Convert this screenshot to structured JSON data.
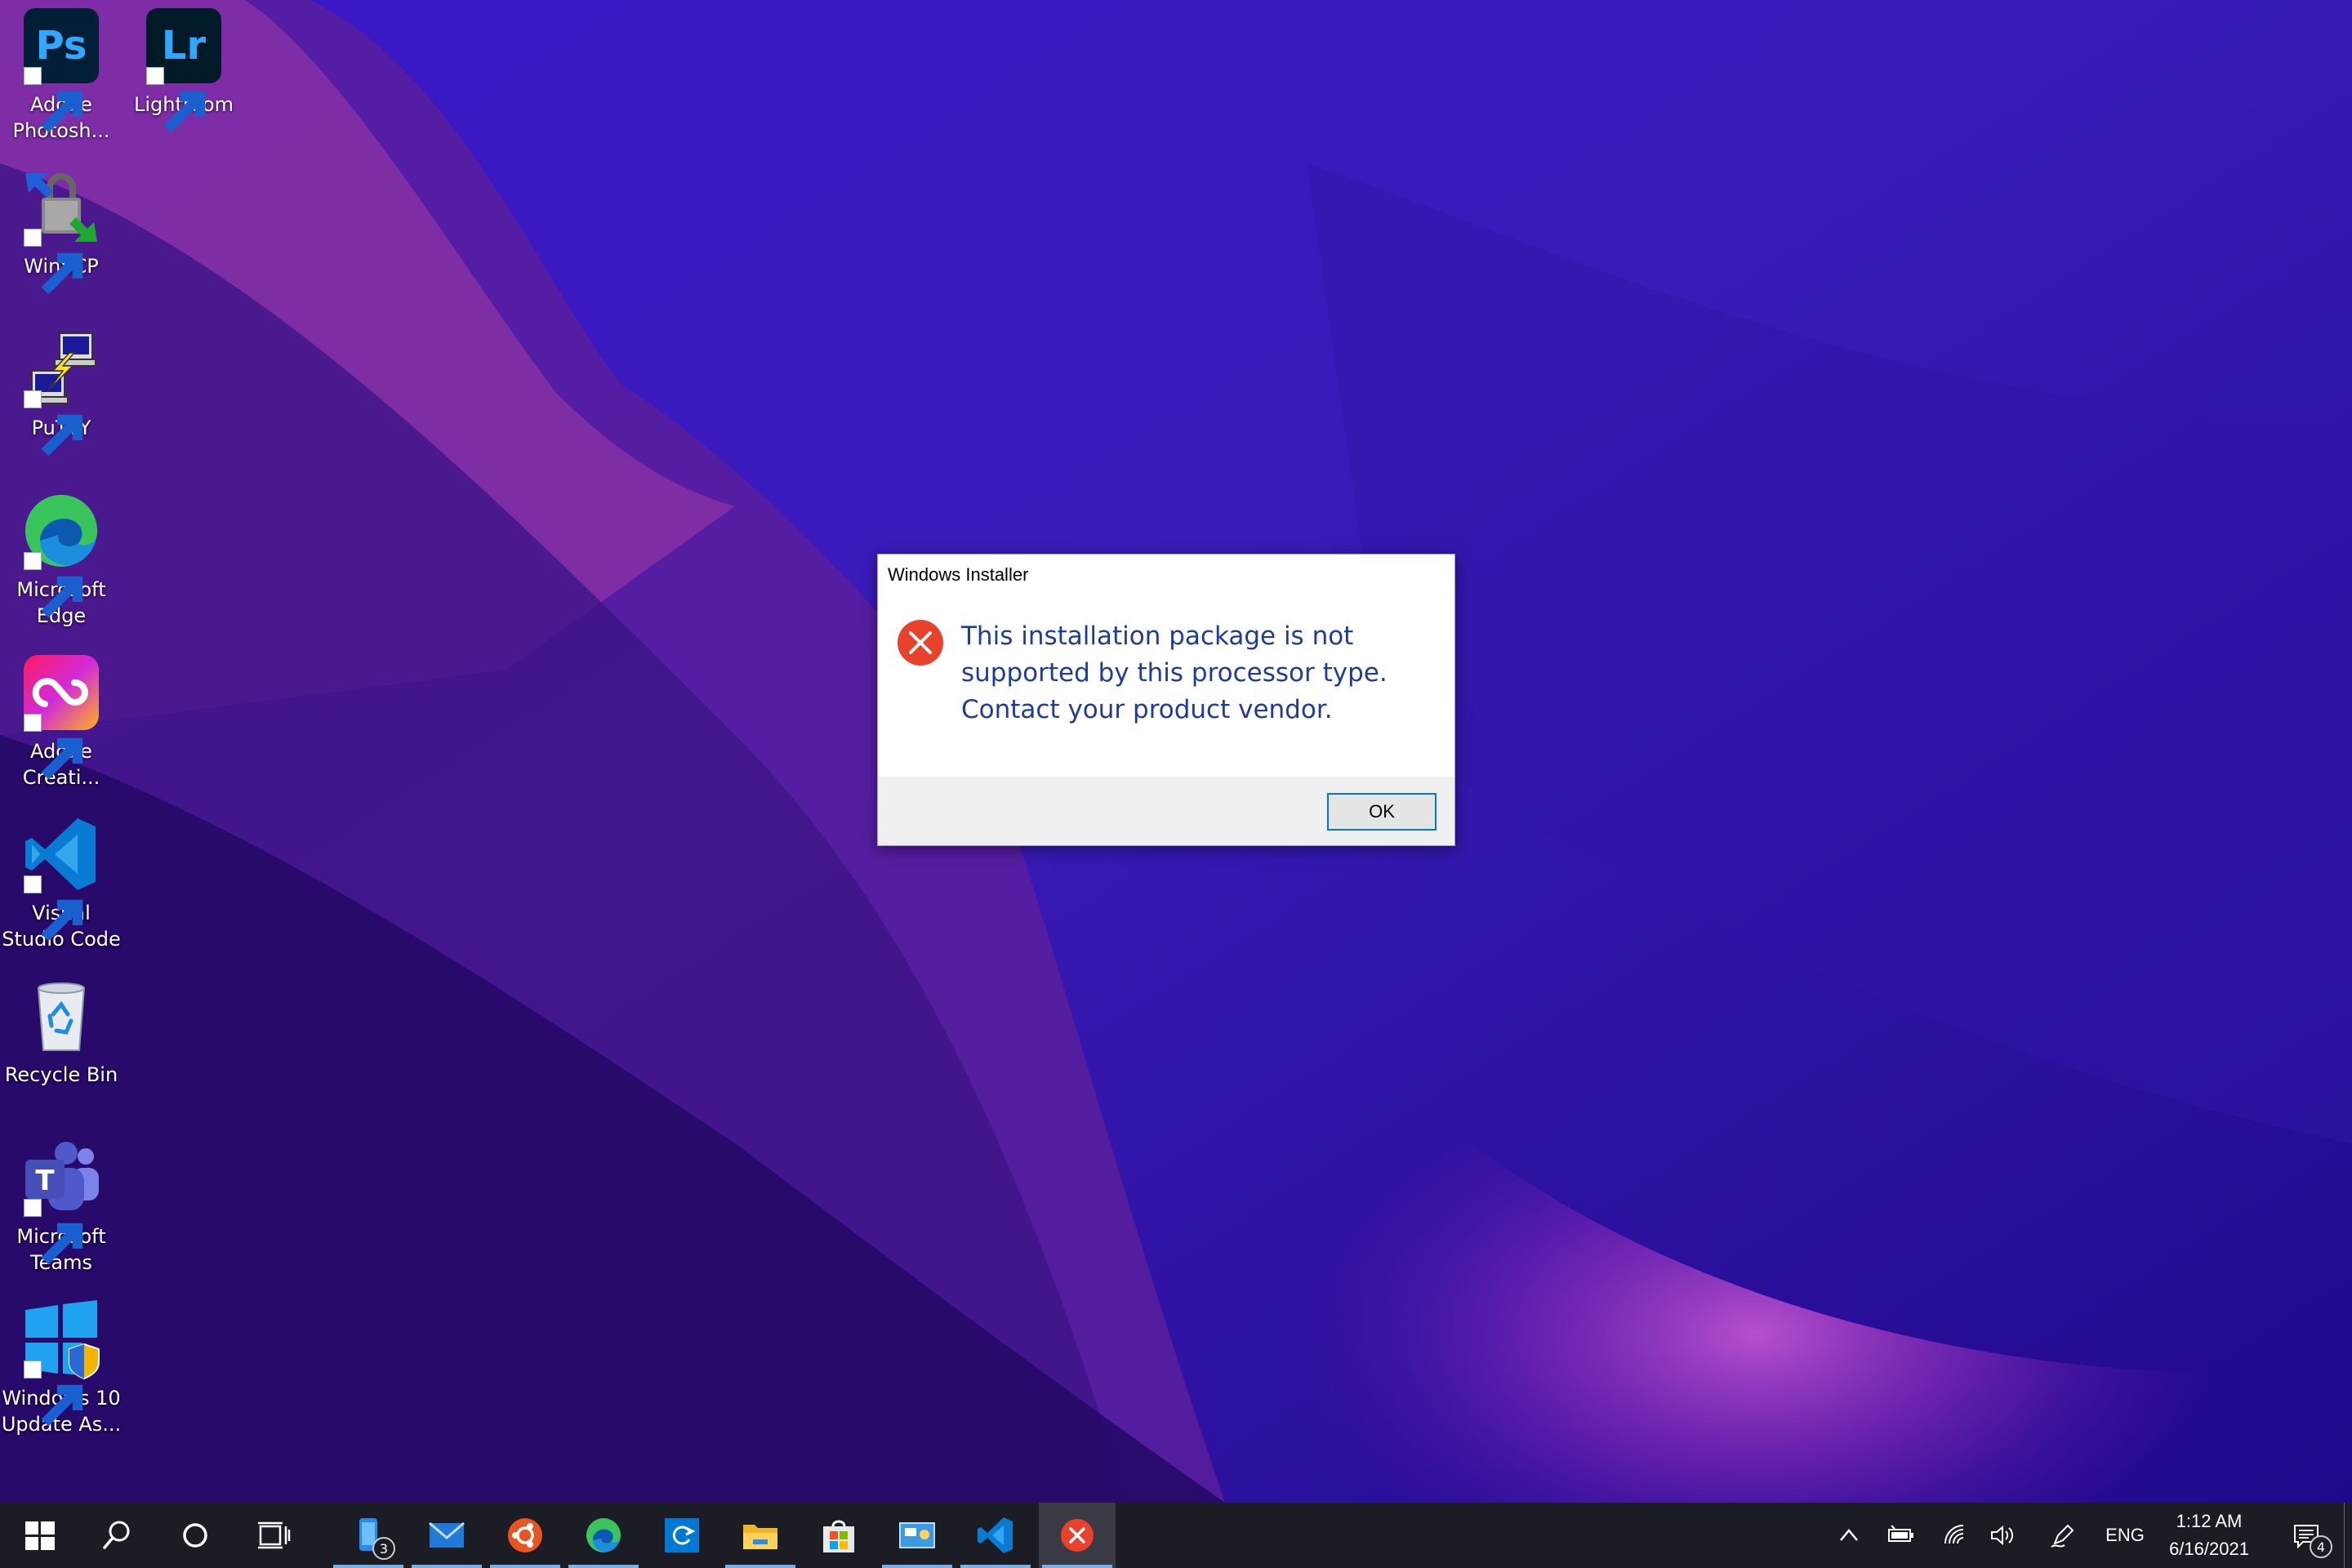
{
  "desktop": {
    "icons": [
      {
        "label": "Adobe Photosh...",
        "icon": "photoshop-icon"
      },
      {
        "label": "Lightroom",
        "icon": "lightroom-icon"
      },
      {
        "label": "WinSCP",
        "icon": "winscp-icon"
      },
      {
        "label": "PuTTY",
        "icon": "putty-icon"
      },
      {
        "label": "Microsoft Edge",
        "icon": "edge-icon"
      },
      {
        "label": "Adobe Creati...",
        "icon": "creative-cloud-icon"
      },
      {
        "label": "Visual Studio Code",
        "icon": "vscode-icon"
      },
      {
        "label": "Recycle Bin",
        "icon": "recycle-bin-icon"
      },
      {
        "label": "Microsoft Teams",
        "icon": "teams-icon"
      },
      {
        "label": "Windows 10 Update As...",
        "icon": "windows-update-assistant-icon"
      }
    ],
    "icon_text": {
      "ps": "Ps",
      "lr": "Lr",
      "teams": "T"
    }
  },
  "dialog": {
    "title": "Windows Installer",
    "message_lines": [
      "This installation package is not",
      "supported by this processor type.",
      "Contact your product vendor."
    ],
    "ok_label": "OK",
    "icon": "error-icon"
  },
  "taskbar": {
    "apps": [
      {
        "name": "phone-app",
        "badge": "3"
      },
      {
        "name": "mail"
      },
      {
        "name": "ubuntu"
      },
      {
        "name": "edge"
      },
      {
        "name": "remote-desktop"
      },
      {
        "name": "file-explorer"
      },
      {
        "name": "microsoft-store"
      },
      {
        "name": "control-panel"
      },
      {
        "name": "vscode"
      },
      {
        "name": "error-dialog",
        "focused": true
      }
    ],
    "language": "ENG",
    "time": "1:12 AM",
    "date": "6/16/2021",
    "notification_count": "4"
  },
  "colors": {
    "dialog_message": "#1f3c99",
    "error_red": "#e81123",
    "taskbar": "#1c1c24",
    "button_border": "#0078d7"
  }
}
